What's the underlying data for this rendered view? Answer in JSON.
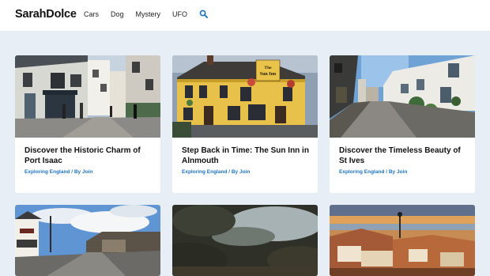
{
  "header": {
    "site_title": "SarahDolce",
    "nav": [
      "Cars",
      "Dog",
      "Mystery",
      "UFO"
    ],
    "search_icon": "search-icon"
  },
  "colors": {
    "background": "#e8eef6",
    "accent_link": "#1e73be",
    "search_icon": "#1e73be"
  },
  "cards": [
    {
      "title": "Discover the Historic Charm of Port Isaac",
      "category": "Exploring England",
      "by": "/ By",
      "author": "Join"
    },
    {
      "title": "Step Back in Time: The Sun Inn in Alnmouth",
      "category": "Exploring England",
      "by": "/ By",
      "author": "Join",
      "sign_text": "The Sun Inn"
    },
    {
      "title": "Discover the Timeless Beauty of St Ives",
      "category": "Exploring England",
      "by": "/ By",
      "author": "Join"
    }
  ]
}
